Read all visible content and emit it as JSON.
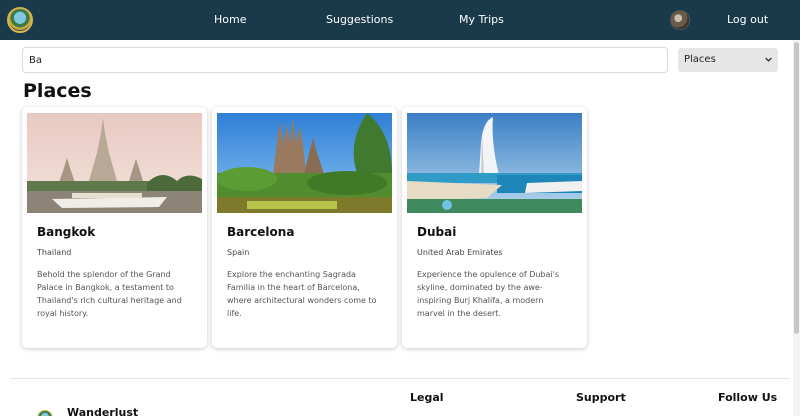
{
  "nav": {
    "logo_icon": "wanderlust-globe-logo",
    "links": [
      "Home",
      "Suggestions",
      "My Trips"
    ],
    "avatar_icon": "user-avatar",
    "logout": "Log out",
    "background": "#1a3a4c"
  },
  "search": {
    "value": "Ba",
    "placeholder": ""
  },
  "filter": {
    "selected": "Places",
    "icon": "chevron-down-icon"
  },
  "section": {
    "title": "Places"
  },
  "cards": [
    {
      "name": "Bangkok",
      "country": "Thailand",
      "description": "Behold the splendor of the Grand Palace in Bangkok, a testament to Thailand's rich cultural heritage and royal history.",
      "image": "temple-riverside-photo"
    },
    {
      "name": "Barcelona",
      "country": "Spain",
      "description": "Explore the enchanting Sagrada Familia in the heart of Barcelona, where architectural wonders come to life.",
      "image": "basilica-park-photo"
    },
    {
      "name": "Dubai",
      "country": "United Arab Emirates",
      "description": "Experience the opulence of Dubai's skyline, dominated by the awe-inspiring Burj Khalifa, a modern marvel in the desert.",
      "image": "sail-hotel-beach-photo"
    }
  ],
  "footer": {
    "brand": "Wanderlust",
    "columns": [
      "Legal",
      "Support",
      "Follow Us"
    ]
  }
}
